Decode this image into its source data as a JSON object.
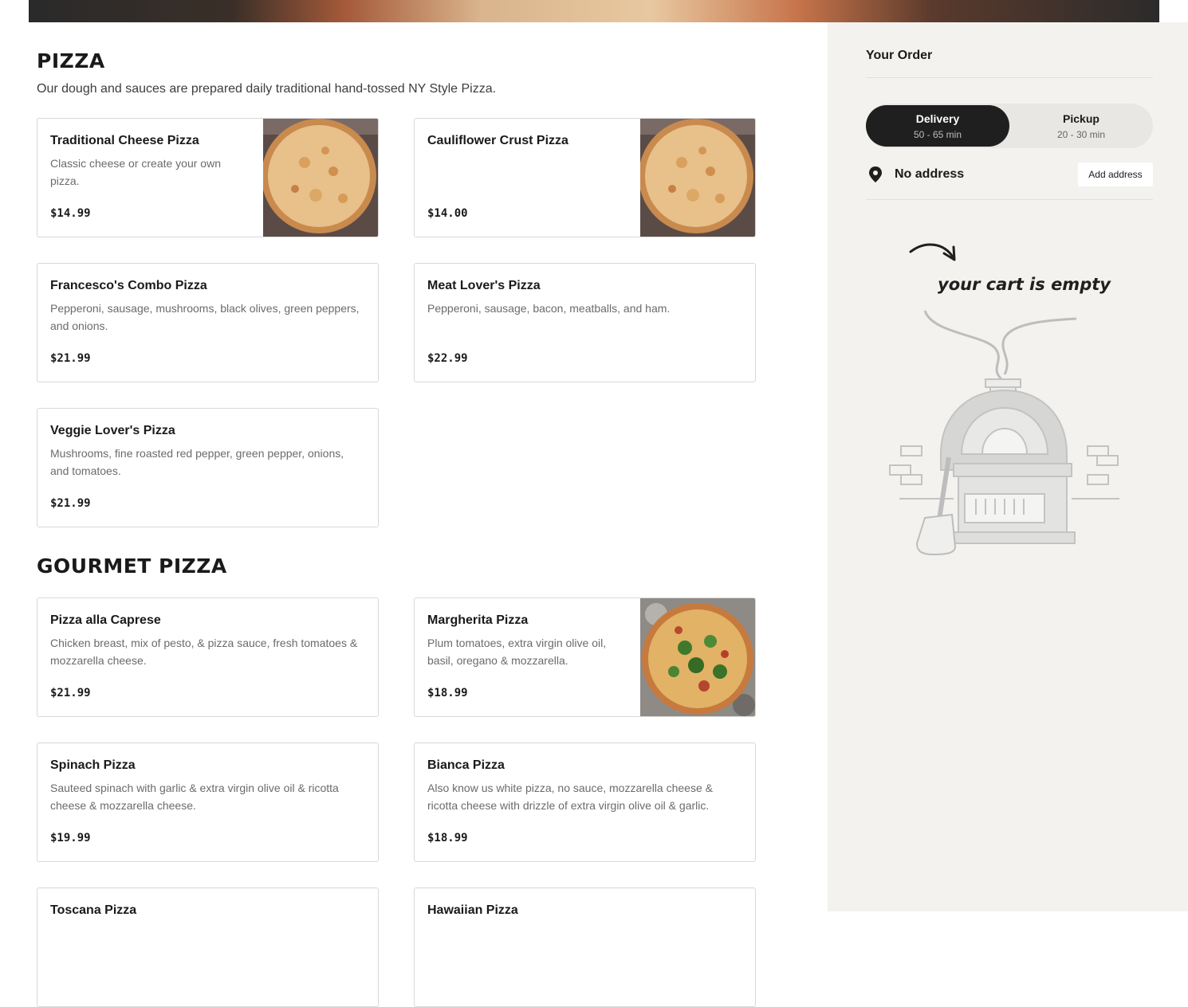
{
  "sections": [
    {
      "title": "PIZZA",
      "description": "Our dough and sauces are prepared daily traditional hand-tossed NY Style Pizza.",
      "items": [
        {
          "name": "Traditional Cheese Pizza",
          "description": "Classic cheese or create your own pizza.",
          "price": "$14.99",
          "image": "cheese-pizza"
        },
        {
          "name": "Cauliflower Crust Pizza",
          "description": "",
          "price": "$14.00",
          "image": "cheese-pizza"
        },
        {
          "name": "Francesco's Combo Pizza",
          "description": "Pepperoni, sausage, mushrooms, black olives, green peppers, and onions.",
          "price": "$21.99"
        },
        {
          "name": "Meat Lover's Pizza",
          "description": "Pepperoni, sausage, bacon, meatballs, and ham.",
          "price": "$22.99"
        },
        {
          "name": "Veggie Lover's Pizza",
          "description": "Mushrooms, fine roasted red pepper, green pepper, onions, and tomatoes.",
          "price": "$21.99"
        }
      ]
    },
    {
      "title": "GOURMET PIZZA",
      "items": [
        {
          "name": "Pizza alla Caprese",
          "description": "Chicken breast, mix of pesto, & pizza sauce, fresh tomatoes & mozzarella cheese.",
          "price": "$21.99"
        },
        {
          "name": "Margherita Pizza",
          "description": "Plum tomatoes, extra virgin olive oil, basil, oregano & mozzarella.",
          "price": "$18.99",
          "image": "margherita-pizza"
        },
        {
          "name": "Spinach Pizza",
          "description": "Sauteed spinach with garlic & extra virgin olive oil & ricotta cheese & mozzarella cheese.",
          "price": "$19.99"
        },
        {
          "name": "Bianca Pizza",
          "description": "Also know us white pizza, no sauce, mozzarella cheese & ricotta cheese with drizzle of extra virgin olive oil & garlic.",
          "price": "$18.99"
        },
        {
          "name": "Toscana Pizza",
          "description": "",
          "price": ""
        },
        {
          "name": "Hawaiian Pizza",
          "description": "",
          "price": ""
        }
      ]
    }
  ],
  "order": {
    "title": "Your Order",
    "delivery": {
      "label": "Delivery",
      "time": "50 - 65 min",
      "active": true
    },
    "pickup": {
      "label": "Pickup",
      "time": "20 - 30 min",
      "active": false
    },
    "address": {
      "icon": "location-pin-icon",
      "text": "No address",
      "button": "Add address"
    },
    "empty_text": "your cart is empty"
  },
  "colors": {
    "sidebar_bg": "#f3f2ef",
    "toggle_active": "#1f1f1f",
    "toggle_bg": "#e8e7e3",
    "card_border": "#d8d8d8"
  }
}
